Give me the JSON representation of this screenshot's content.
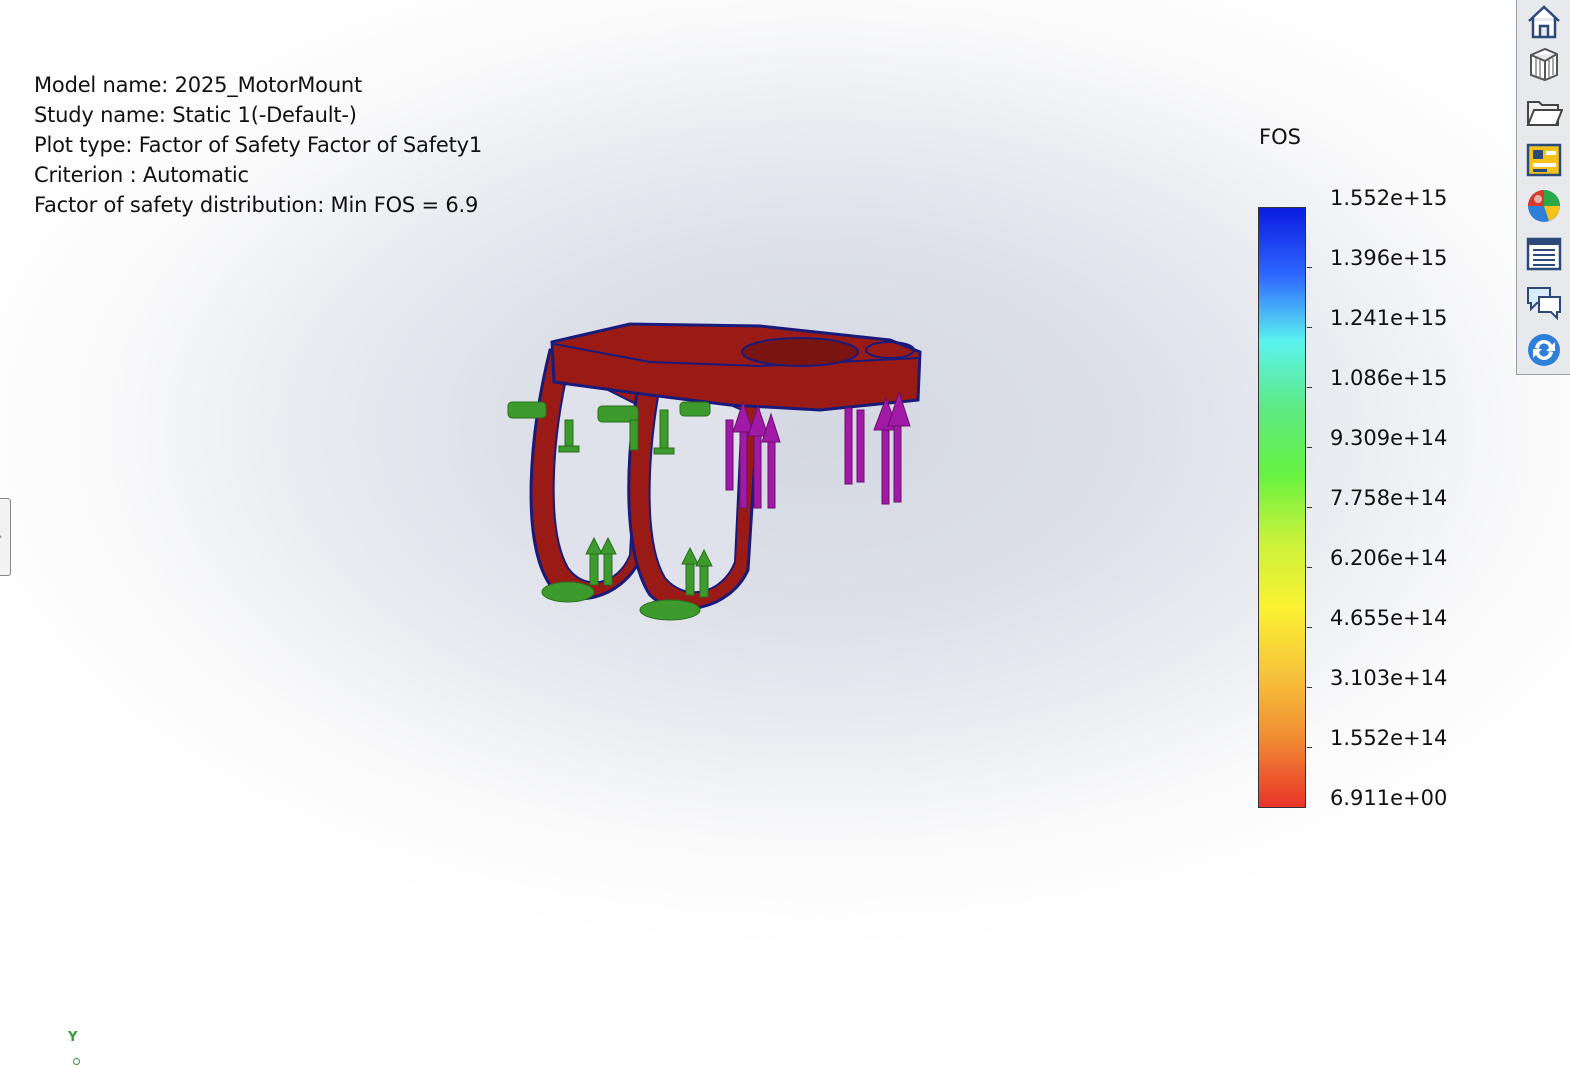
{
  "info": {
    "model_name": "Model name: 2025_MotorMount",
    "study_name": "Study name: Static 1(-Default-)",
    "plot_type": "Plot type: Factor of Safety Factor of Safety1",
    "criterion": "Criterion : Automatic",
    "distribution": "Factor of safety distribution: Min FOS = 6.9"
  },
  "legend": {
    "title": "FOS",
    "labels": [
      "1.552e+15",
      "1.396e+15",
      "1.241e+15",
      "1.086e+15",
      "9.309e+14",
      "7.758e+14",
      "6.206e+14",
      "4.655e+14",
      "3.103e+14",
      "1.552e+14",
      "6.911e+00"
    ],
    "gradient_colors": [
      "#0a1be0",
      "#2e66ff",
      "#5bf2ef",
      "#5dea84",
      "#66f240",
      "#c9f23a",
      "#fbf233",
      "#f7c43a",
      "#f08a32",
      "#e8332a"
    ]
  },
  "model": {
    "part_color": "#9a1b16",
    "edge_color": "#1a1a7a",
    "fixture_color": "#3d9a2c",
    "load_color": "#a11aa6"
  },
  "toolbar": {
    "icons": [
      "home-icon",
      "3d-box-icon",
      "open-folder-icon",
      "display-manager-icon",
      "appearance-sphere-icon",
      "list-view-icon",
      "comments-icon",
      "refresh-icon"
    ]
  },
  "triad": {
    "y_label": "Y"
  }
}
